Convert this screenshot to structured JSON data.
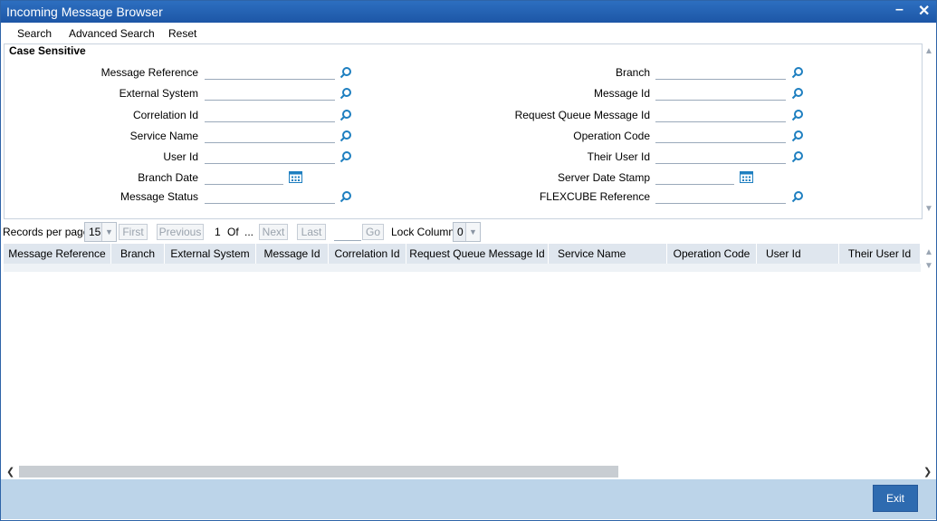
{
  "window": {
    "title": "Incoming Message Browser",
    "minimize_glyph": "–",
    "close_glyph": "✕"
  },
  "menu": {
    "search": "Search",
    "advanced_search": "Advanced Search",
    "reset": "Reset"
  },
  "criteria": {
    "legend": "Case Sensitive",
    "left": [
      {
        "label": "Message Reference",
        "value": "",
        "icon": "search-icon"
      },
      {
        "label": "External System",
        "value": "",
        "icon": "search-icon"
      },
      {
        "label": "Correlation Id",
        "value": "",
        "icon": "search-icon"
      },
      {
        "label": "Service Name",
        "value": "",
        "icon": "search-icon"
      },
      {
        "label": "User Id",
        "value": "",
        "icon": "search-icon"
      },
      {
        "label": "Branch Date",
        "value": "",
        "icon": "calendar-icon"
      },
      {
        "label": "Message Status",
        "value": "",
        "icon": "search-icon"
      }
    ],
    "right": [
      {
        "label": "Branch",
        "value": "",
        "icon": "search-icon"
      },
      {
        "label": "Message Id",
        "value": "",
        "icon": "search-icon"
      },
      {
        "label": "Request Queue Message Id",
        "value": "",
        "icon": "search-icon"
      },
      {
        "label": "Operation Code",
        "value": "",
        "icon": "search-icon"
      },
      {
        "label": "Their User Id",
        "value": "",
        "icon": "search-icon"
      },
      {
        "label": "Server Date Stamp",
        "value": "",
        "icon": "calendar-icon"
      },
      {
        "label": "FLEXCUBE Reference",
        "value": "",
        "icon": "search-icon"
      }
    ]
  },
  "paging": {
    "records_per_page_label": "Records per page",
    "records_per_page_value": "15",
    "first": "First",
    "previous": "Previous",
    "current_page": "1",
    "of_label": "Of",
    "total_pages": "...",
    "next": "Next",
    "last": "Last",
    "go": "Go",
    "lock_columns_label": "Lock Columns",
    "lock_columns_value": "0"
  },
  "grid": {
    "columns": [
      "Message Reference",
      "Branch",
      "External System",
      "Message Id",
      "Correlation Id",
      "Request Queue Message Id",
      "Service Name",
      "Operation Code",
      "User Id",
      "Their User Id"
    ],
    "rows": []
  },
  "footer": {
    "exit": "Exit"
  },
  "colors": {
    "titlebar": "#1d56a6",
    "footer": "#bcd4e9",
    "accent_icon": "#1e7fc0"
  }
}
